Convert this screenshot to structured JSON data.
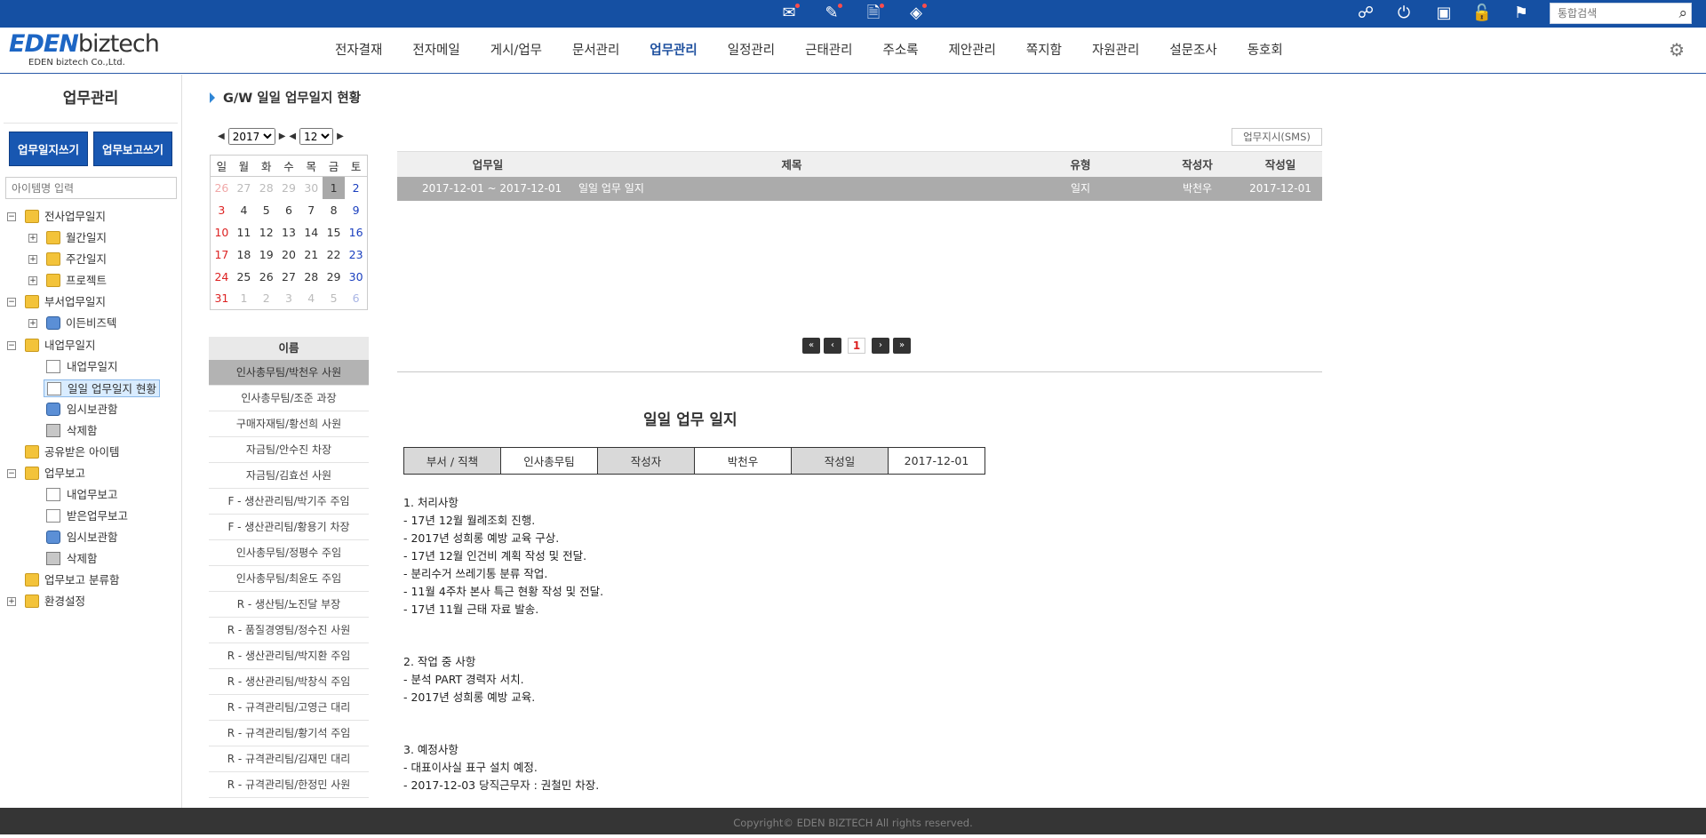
{
  "topbar": {
    "icons": [
      "mail-icon",
      "note-icon",
      "document-icon",
      "gift-icon"
    ],
    "right_icons": [
      "org-chart-icon",
      "power-icon",
      "image-icon",
      "lock-icon",
      "flag-icon"
    ],
    "search_placeholder": "통합검색"
  },
  "header": {
    "logo_main": "EDEN",
    "logo_tail": "biztech",
    "logo_sub": "EDEN biztech Co.,Ltd.",
    "nav": [
      "전자결재",
      "전자메일",
      "게시/업무",
      "문서관리",
      "업무관리",
      "일정관리",
      "근태관리",
      "주소록",
      "제안관리",
      "쪽지함",
      "자원관리",
      "설문조사",
      "동호회"
    ],
    "active_nav": "업무관리"
  },
  "sidebar": {
    "title": "업무관리",
    "btn_write_log": "업무일지쓰기",
    "btn_write_report": "업무보고쓰기",
    "search_placeholder": "아이템명 입력",
    "tree": [
      {
        "label": "전사업무일지"
      },
      {
        "label": "월간일지"
      },
      {
        "label": "주간일지"
      },
      {
        "label": "프로젝트"
      },
      {
        "label": "부서업무일지"
      },
      {
        "label": "이든비즈텍"
      },
      {
        "label": "내업무일지"
      },
      {
        "label": "내업무일지"
      },
      {
        "label": "일일 업무일지 현황"
      },
      {
        "label": "임시보관함"
      },
      {
        "label": "삭제함"
      },
      {
        "label": "공유받은 아이템"
      },
      {
        "label": "업무보고"
      },
      {
        "label": "내업무보고"
      },
      {
        "label": "받은업무보고"
      },
      {
        "label": "임시보관함"
      },
      {
        "label": "삭제함"
      },
      {
        "label": "업무보고 분류함"
      },
      {
        "label": "환경설정"
      }
    ]
  },
  "breadcrumb": "G/W 일일 업무일지 현황",
  "calendar": {
    "year": "2017",
    "month": "12",
    "weekdays": [
      "일",
      "월",
      "화",
      "수",
      "목",
      "금",
      "토"
    ],
    "weeks": [
      [
        "26",
        "27",
        "28",
        "29",
        "30",
        "1",
        "2"
      ],
      [
        "3",
        "4",
        "5",
        "6",
        "7",
        "8",
        "9"
      ],
      [
        "10",
        "11",
        "12",
        "13",
        "14",
        "15",
        "16"
      ],
      [
        "17",
        "18",
        "19",
        "20",
        "21",
        "22",
        "23"
      ],
      [
        "24",
        "25",
        "26",
        "27",
        "28",
        "29",
        "30"
      ],
      [
        "31",
        "1",
        "2",
        "3",
        "4",
        "5",
        "6"
      ]
    ],
    "today": "1"
  },
  "names": {
    "header": "이름",
    "items": [
      "인사총무팀/박천우 사원",
      "인사총무팀/조준 과장",
      "구매자재팀/황선희 사원",
      "자금팀/안수진 차장",
      "자금팀/김효선 사원",
      "F - 생산관리팀/박기주 주임",
      "F - 생산관리팀/황용기 차장",
      "인사총무팀/정평수 주임",
      "인사총무팀/최윤도 주임",
      "R - 생산팀/노진달 부장",
      "R - 품질경영팀/정수진 사원",
      "R - 생산관리팀/박지환 주임",
      "R - 생산관리팀/박창식 주임",
      "R - 규격관리팀/고영근 대리",
      "R - 규격관리팀/황기석 주임",
      "R - 규격관리팀/김재민 대리",
      "R - 규격관리팀/한정민 사원"
    ]
  },
  "list": {
    "sms_button": "업무지시(SMS)",
    "headers": {
      "date": "업무일",
      "title": "제목",
      "type": "유형",
      "author": "작성자",
      "created": "작성일"
    },
    "rows": [
      {
        "date": "2017-12-01 ~ 2017-12-01",
        "title": "일일 업무 일지",
        "type": "일지",
        "author": "박천우",
        "created": "2017-12-01"
      }
    ]
  },
  "pager": {
    "first": "«",
    "prev": "‹",
    "page": "1",
    "next": "›",
    "last": "»"
  },
  "detail": {
    "title": "일일 업무 일지",
    "dept_label": "부서 / 직책",
    "dept_value": "인사총무팀",
    "author_label": "작성자",
    "author_value": "박천우",
    "date_label": "작성일",
    "date_value": "2017-12-01",
    "sections": [
      {
        "heading": "1. 처리사항",
        "lines": [
          "- 17년 12월 월례조회 진행.",
          "- 2017년 성희롱 예방 교육 구상.",
          "- 17년 12월 인건비 계획 작성 및 전달.",
          "- 분리수거 쓰레기통 분류 작업.",
          "- 11월 4주차 본사 특근 현황 작성 및 전달.",
          "- 17년 11월 근태 자료 발송."
        ]
      },
      {
        "heading": "2. 작업 중 사항",
        "lines": [
          "- 분석 PART 경력자 서치.",
          "- 2017년 성희롱 예방 교육."
        ]
      },
      {
        "heading": "3. 예정사항",
        "lines": [
          "- 대표이사실 표구 설치 예정.",
          "- 2017-12-03 당직근무자 : 권철민 차장."
        ]
      }
    ]
  },
  "footer": "Copyright© EDEN BIZTECH All rights reserved."
}
